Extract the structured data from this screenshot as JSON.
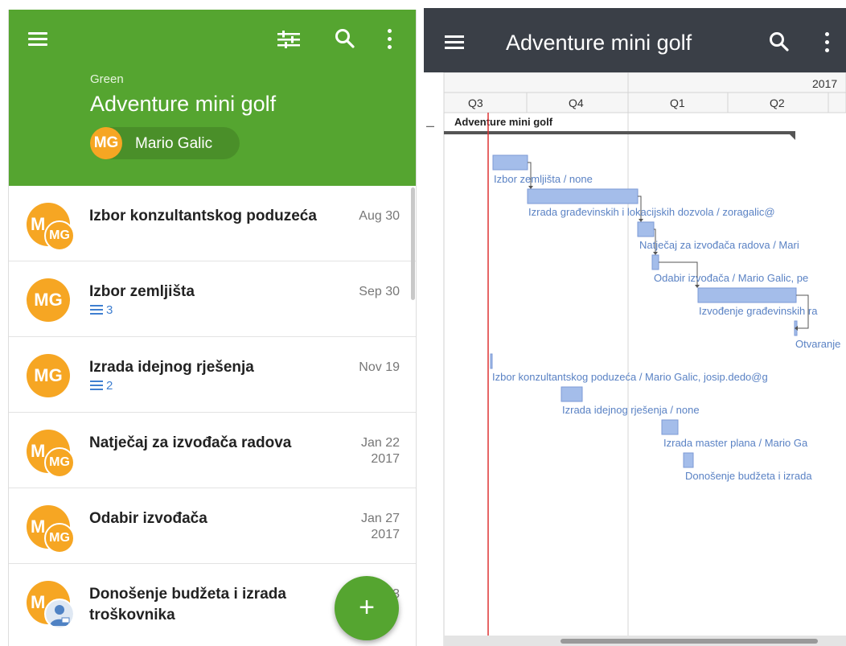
{
  "left": {
    "header": {
      "menu_icon": "menu-icon",
      "filter_icon": "tune-icon",
      "search_icon": "search-icon",
      "more_icon": "more-vert-icon",
      "category": "Green",
      "project_title": "Adventure mini golf",
      "owner_initials": "MG",
      "owner_name": "Mario Galic",
      "color": "#55a530"
    },
    "tasks": [
      {
        "title": "Izbor konzultantskog poduzeća",
        "date": "Aug 30",
        "year": "",
        "avatar_main": "M",
        "avatar_sub": "MG",
        "avatar_type": "double",
        "subtasks": ""
      },
      {
        "title": "Izbor zemljišta",
        "date": "Sep 30",
        "year": "",
        "avatar_main": "MG",
        "avatar_sub": "",
        "avatar_type": "single",
        "subtasks": "3"
      },
      {
        "title": "Izrada idejnog rješenja",
        "date": "Nov 19",
        "year": "",
        "avatar_main": "MG",
        "avatar_sub": "",
        "avatar_type": "single",
        "subtasks": "2"
      },
      {
        "title": "Natječaj za izvođača radova",
        "date": "Jan 22",
        "year": "2017",
        "avatar_main": "M",
        "avatar_sub": "MG",
        "avatar_type": "double",
        "subtasks": ""
      },
      {
        "title": "Odabir izvođača",
        "date": "Jan 27",
        "year": "2017",
        "avatar_main": "M",
        "avatar_sub": "MG",
        "avatar_type": "double",
        "subtasks": ""
      },
      {
        "title": "Donošenje budžeta i izrada troškovnika",
        "date": "3",
        "year": "",
        "avatar_main": "M",
        "avatar_sub": "",
        "avatar_type": "person",
        "subtasks": ""
      }
    ],
    "fab_label": "+"
  },
  "right": {
    "header": {
      "menu_icon": "menu-icon",
      "title": "Adventure mini golf",
      "search_icon": "search-icon",
      "more_icon": "more-vert-icon",
      "color": "#3a3f47"
    },
    "timeline": {
      "year": "2017",
      "quarters": [
        "Q3",
        "Q4",
        "Q1",
        "Q2"
      ],
      "project_label": "Adventure mini golf",
      "collapse_symbol": "–"
    },
    "tasks": [
      {
        "label": "Izbor zemljišta / none"
      },
      {
        "label": "Izrada građevinskih i lokacijskih dozvola / zoragalic@"
      },
      {
        "label": "Natječaj za izvođača radova / Mari"
      },
      {
        "label": "Odabir izvođača / Mario Galic, pe"
      },
      {
        "label": "Izvođenje građevinskih ra"
      },
      {
        "label": "Otvaranje"
      },
      {
        "label": "Izbor konzultantskog poduzeća / Mario Galic, josip.dedo@g"
      },
      {
        "label": "Izrada idejnog rješenja / none"
      },
      {
        "label": "Izrada master plana / Mario Ga"
      },
      {
        "label": "Donošenje budžeta i izrada"
      }
    ],
    "colors": {
      "bar": "#a4bdea",
      "bar_border": "#7d9ad6",
      "label": "#5a82c4",
      "today": "#d33"
    }
  }
}
